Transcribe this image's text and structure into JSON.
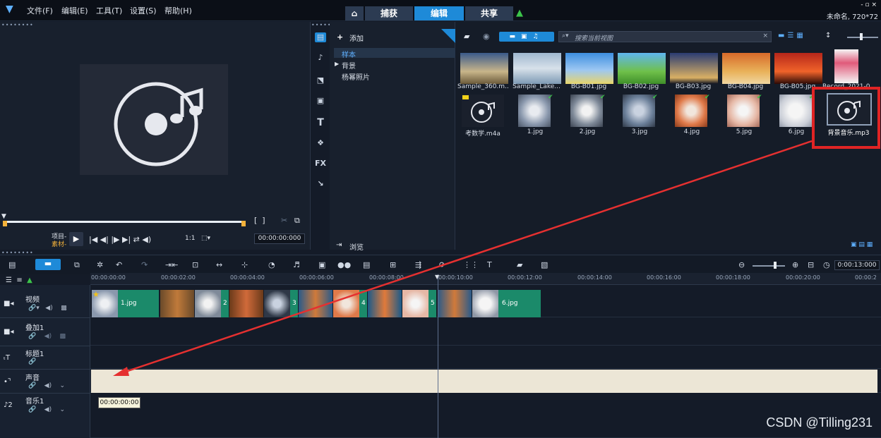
{
  "menu": {
    "items": [
      "文件(F)",
      "编辑(E)",
      "工具(T)",
      "设置(S)",
      "帮助(H)"
    ]
  },
  "steps": {
    "capture": "捕获",
    "edit": "编辑",
    "share": "共享"
  },
  "window": {
    "controls": "- ▫ ×",
    "project_info": "未命名, 720*72"
  },
  "preview": {
    "mode_project": "项目-",
    "mode_clip": "素材-",
    "scale": "1:1",
    "timecode": "00:00:00:000"
  },
  "library": {
    "add_label": "添加",
    "tree": [
      "样本",
      "背景",
      "杨幂照片"
    ],
    "browse_label": "浏览",
    "search_placeholder": "搜索当前视图",
    "thumbs_row1": [
      "Sample_360.m...",
      "Sample_Lake...",
      "BG-B01.jpg",
      "BG-B02.jpg",
      "BG-B03.jpg",
      "BG-B04.jpg",
      "BG-B05.jpg",
      "Record_2021-0..."
    ],
    "thumbs_row2": [
      "考数学.m4a",
      "1.jpg",
      "2.jpg",
      "3.jpg",
      "4.jpg",
      "5.jpg",
      "6.jpg",
      "背景音乐.mp3"
    ]
  },
  "timeline": {
    "timecode": "0:00:13:000",
    "ticks": [
      "00:00:00:00",
      "00:00:02:00",
      "00:00:04:00",
      "00:00:06:00",
      "00:00:08:00",
      "00:00:10:00",
      "00:00:12:00",
      "00:00:14:00",
      "00:00:16:00",
      "00:00:18:00",
      "00:00:20:00",
      "00:00:2"
    ],
    "tracks": [
      "视频",
      "叠加1",
      "标题1",
      "声音",
      "音乐1"
    ],
    "clips": [
      "1.jpg",
      "2",
      "3",
      "4",
      "5",
      "6.jpg"
    ],
    "tooltip": "00:00:00:00"
  },
  "watermark": "CSDN @Tilling231"
}
